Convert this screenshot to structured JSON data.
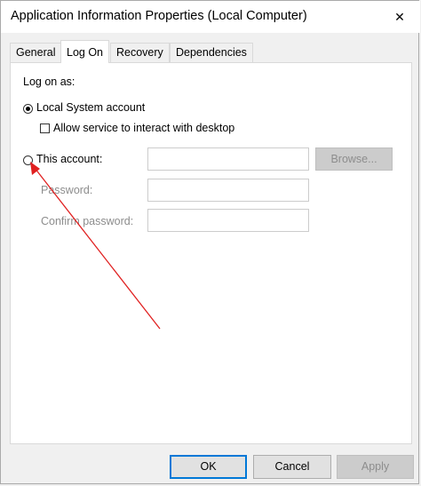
{
  "window": {
    "title": "Application Information Properties (Local Computer)",
    "close_glyph": "✕"
  },
  "tabs": [
    {
      "label": "General",
      "active": false
    },
    {
      "label": "Log On",
      "active": true
    },
    {
      "label": "Recovery",
      "active": false
    },
    {
      "label": "Dependencies",
      "active": false
    }
  ],
  "logon": {
    "group_label": "Log on as:",
    "local_system_label": "Local System account",
    "local_system_selected": true,
    "interact_desktop_label": "Allow service to interact with desktop",
    "interact_desktop_checked": false,
    "this_account_label": "This account:",
    "this_account_selected": false,
    "account_value": "",
    "browse_label": "Browse...",
    "password_label": "Password:",
    "password_value": "",
    "confirm_password_label": "Confirm password:",
    "confirm_password_value": ""
  },
  "buttons": {
    "ok_label": "OK",
    "cancel_label": "Cancel",
    "apply_label": "Apply"
  },
  "annotation": {
    "color": "#e02020"
  }
}
